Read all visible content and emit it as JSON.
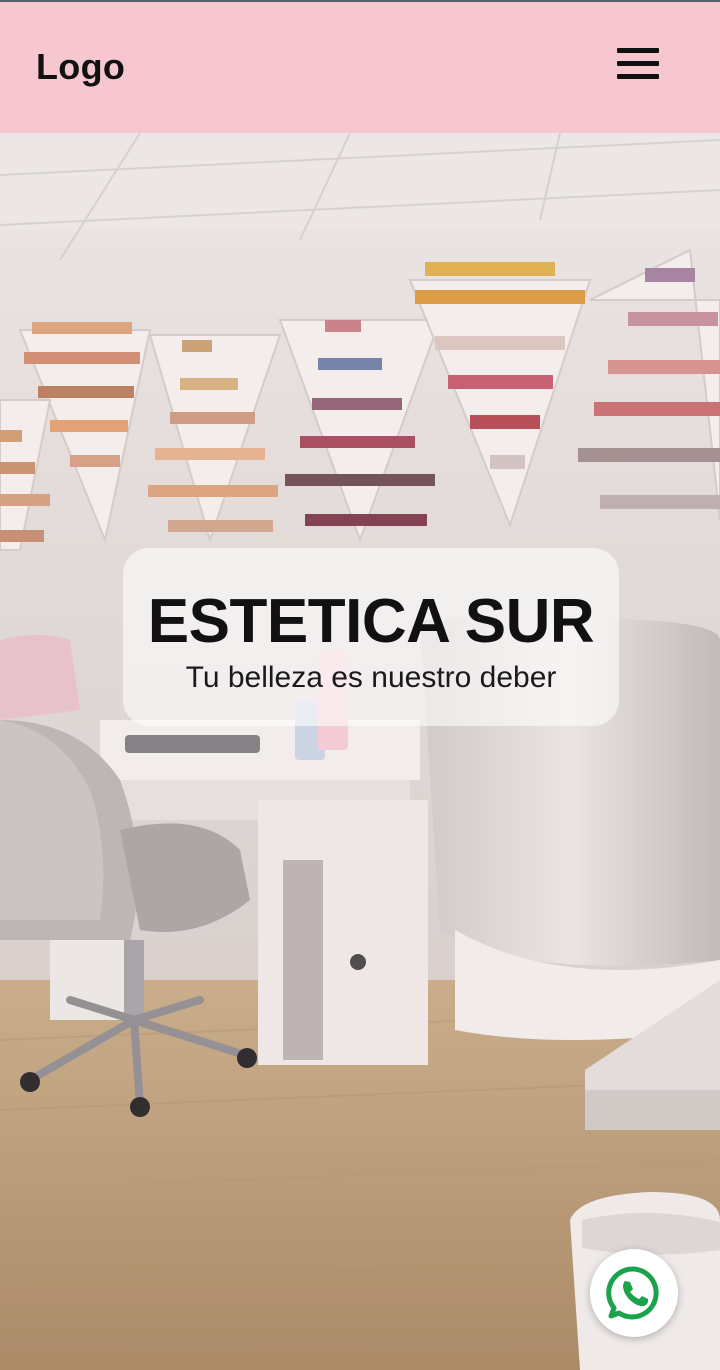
{
  "header": {
    "logo_text": "Logo",
    "menu_icon": "hamburger-menu-icon",
    "background_color": "#f6c4cc"
  },
  "hero": {
    "title": "ESTETICA SUR",
    "subtitle": "Tu belleza es nuestro deber"
  },
  "floating_action": {
    "icon": "whatsapp-icon",
    "color": "#25d366"
  }
}
